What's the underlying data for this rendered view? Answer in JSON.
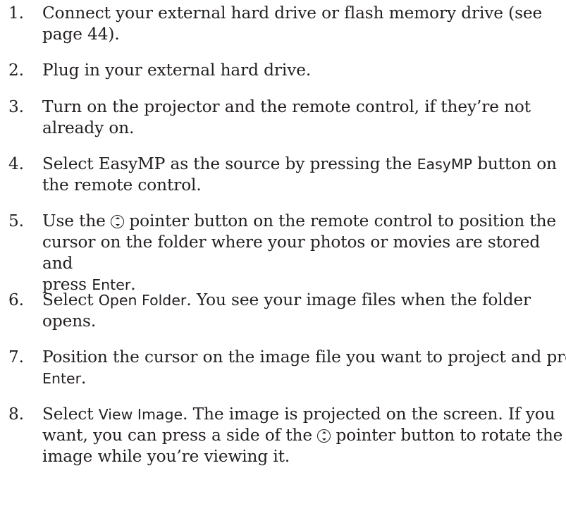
{
  "steps": [
    {
      "number": "1.",
      "line1": "Connect your external hard drive or flash memory drive (see",
      "line2": "page 44)."
    },
    {
      "number": "2.",
      "line1": "Plug in your external hard drive."
    },
    {
      "number": "3.",
      "line1": "Turn on the projector and the remote control, if they’re not",
      "line2": "already on."
    },
    {
      "number": "4.",
      "pre": "Select EasyMP as the source by pressing the ",
      "button": "EasyMP",
      "post": " button on",
      "line2": "the remote control."
    },
    {
      "number": "5.",
      "pre": "Use the ",
      "post": " pointer button on the remote control to position the",
      "line2": "cursor on the folder where your photos or movies are stored and",
      "line3_pre": "press ",
      "button": "Enter",
      "line3_post": "."
    },
    {
      "number": "6.",
      "pre": "Select ",
      "button": "Open Folder",
      "post": ". You see your image files when the folder",
      "line2": "opens."
    },
    {
      "number": "7.",
      "line1": "Position the cursor on the image file you want to project and press",
      "button": "Enter",
      "line2_post": "."
    },
    {
      "number": "8.",
      "pre": "Select ",
      "button": "View Image",
      "post": ". The image is projected on the screen. If you",
      "line2_pre": "want, you can press a side of the ",
      "line2_post": " pointer button to rotate the",
      "line3": "image while you’re viewing it."
    }
  ],
  "icons": {
    "pointer": "pointer-button-icon"
  }
}
